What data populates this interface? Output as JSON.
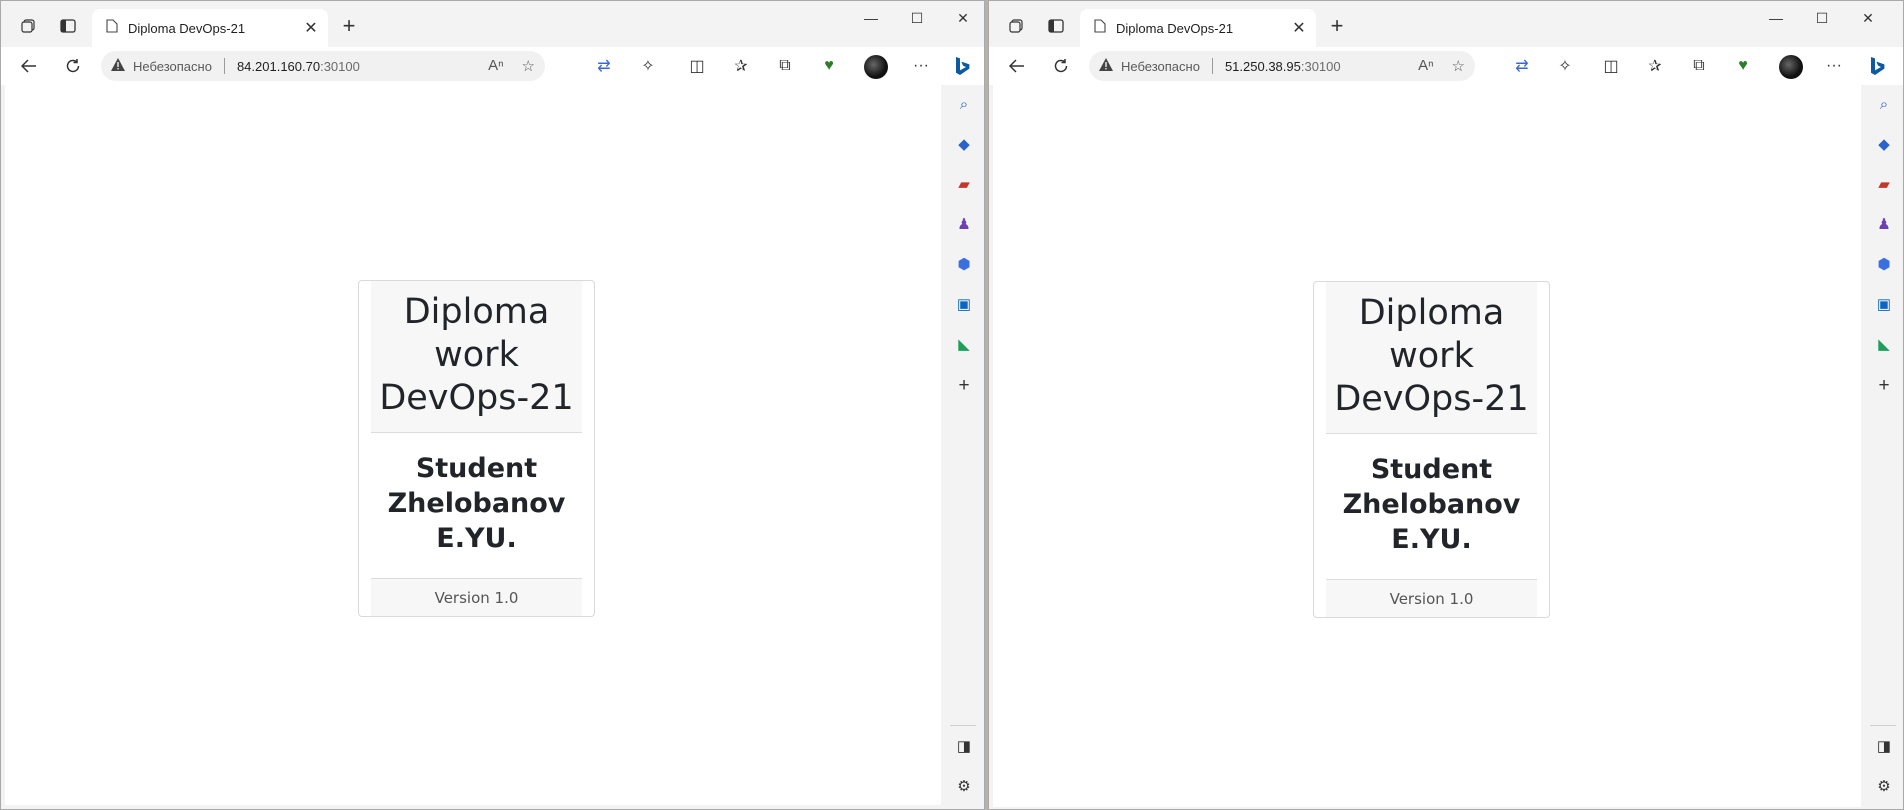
{
  "windows": [
    {
      "tab_title": "Diploma DevOps-21",
      "address": {
        "security_label": "Небезопасно",
        "host": "84.201.160.70",
        "port": ":30100"
      },
      "card": {
        "title": "Diploma work DevOps-21",
        "body": "Student Zhelobanov E.YU.",
        "footer": "Version 1.0"
      }
    },
    {
      "tab_title": "Diploma DevOps-21",
      "address": {
        "security_label": "Небезопасно",
        "host": "51.250.38.95",
        "port": ":30100"
      },
      "card": {
        "title": "Diploma work DevOps-21",
        "body": "Student Zhelobanov E.YU.",
        "footer": "Version 1.0"
      }
    }
  ],
  "icons": {
    "tab_actions": "tab-actions-icon",
    "vertical_tabs": "vertical-tabs-icon",
    "page": "page-icon",
    "back": "back-arrow-icon",
    "refresh": "refresh-icon",
    "warning": "warning-icon",
    "read_aloud": "read-aloud-icon",
    "favorite": "star-icon",
    "translate": "translate-icon",
    "extensions": "extensions-icon",
    "split": "split-screen-icon",
    "favorites": "favorites-icon",
    "collections": "collections-icon",
    "performance": "performance-icon",
    "more": "more-icon",
    "bing": "bing-icon"
  },
  "colors": {
    "accent": "#0c59a4",
    "card_header_bg": "#f7f7f7"
  }
}
